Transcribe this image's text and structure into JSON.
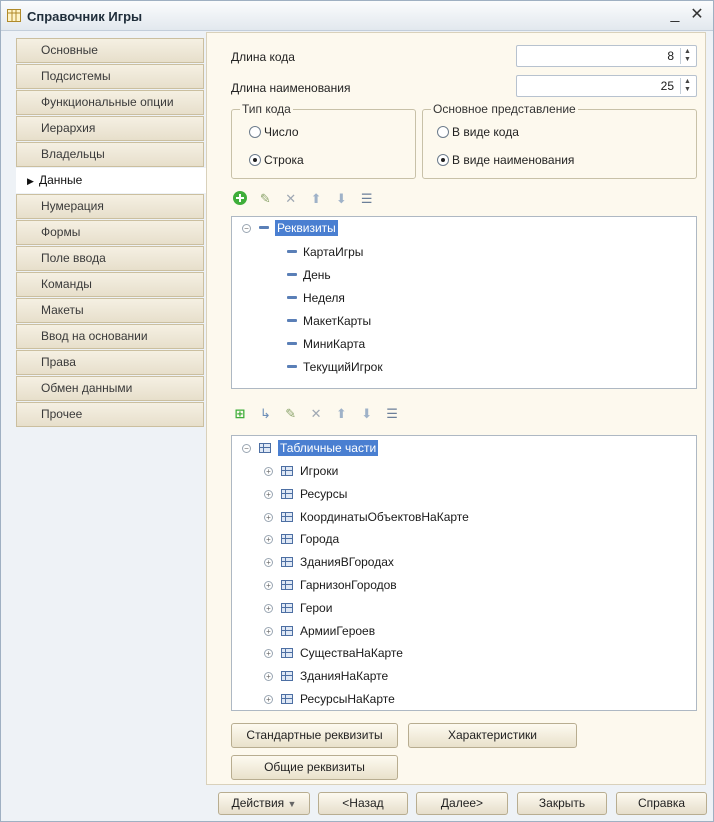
{
  "window": {
    "title": "Справочник Игры",
    "minimize": "_",
    "close": "✕",
    "icon": "table-icon"
  },
  "tabs": [
    {
      "label": "Основные",
      "active": false
    },
    {
      "label": "Подсистемы",
      "active": false
    },
    {
      "label": "Функциональные опции",
      "active": false
    },
    {
      "label": "Иерархия",
      "active": false
    },
    {
      "label": "Владельцы",
      "active": false
    },
    {
      "label": "Данные",
      "active": true
    },
    {
      "label": "Нумерация",
      "active": false
    },
    {
      "label": "Формы",
      "active": false
    },
    {
      "label": "Поле ввода",
      "active": false
    },
    {
      "label": "Команды",
      "active": false
    },
    {
      "label": "Макеты",
      "active": false
    },
    {
      "label": "Ввод на основании",
      "active": false
    },
    {
      "label": "Права",
      "active": false
    },
    {
      "label": "Обмен данными",
      "active": false
    },
    {
      "label": "Прочее",
      "active": false
    }
  ],
  "form": {
    "code_length_label": "Длина кода",
    "code_length_value": "8",
    "name_length_label": "Длина наименования",
    "name_length_value": "25",
    "code_type": {
      "title": "Тип кода",
      "options": [
        "Число",
        "Строка"
      ],
      "selected": "Строка"
    },
    "representation": {
      "title": "Основное представление",
      "options": [
        "В виде кода",
        "В виде наименования"
      ],
      "selected": "В виде наименования"
    }
  },
  "attributes": {
    "root": "Реквизиты",
    "items": [
      "КартаИгры",
      "День",
      "Неделя",
      "МакетКарты",
      "МиниКарта",
      "ТекущийИгрок"
    ]
  },
  "tabular_sections": {
    "root": "Табличные части",
    "items": [
      "Игроки",
      "Ресурсы",
      "КоординатыОбъектовНаКарте",
      "Города",
      "ЗданияВГородах",
      "ГарнизонГородов",
      "Герои",
      "АрмииГероев",
      "СуществаНаКарте",
      "ЗданияНаКарте",
      "РесурсыНаКарте"
    ]
  },
  "buttons": {
    "standard_attributes": "Стандартные реквизиты",
    "characteristics": "Характеристики",
    "common_attributes": "Общие реквизиты"
  },
  "footer": {
    "actions": "Действия",
    "back": "<Назад",
    "next": "Далее>",
    "close": "Закрыть",
    "help": "Справка"
  }
}
